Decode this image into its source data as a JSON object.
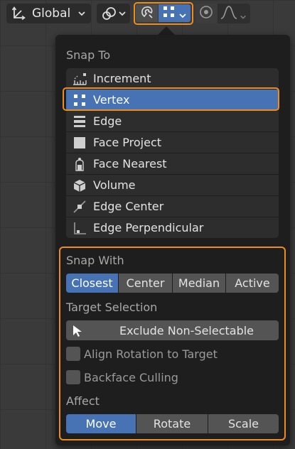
{
  "header": {
    "orientation_label": "Global"
  },
  "colors": {
    "accent": "#4772b3",
    "highlight": "#f08c1a",
    "popover_bg": "#1e1e1e",
    "button_bg": "#545454"
  },
  "snap_to": {
    "title": "Snap To",
    "items": [
      {
        "label": "Increment",
        "icon": "increment-icon",
        "selected": false
      },
      {
        "label": "Vertex",
        "icon": "vertex-icon",
        "selected": true
      },
      {
        "label": "Edge",
        "icon": "edge-icon",
        "selected": false
      },
      {
        "label": "Face Project",
        "icon": "face-project-icon",
        "selected": false
      },
      {
        "label": "Face Nearest",
        "icon": "face-nearest-icon",
        "selected": false
      },
      {
        "label": "Volume",
        "icon": "volume-icon",
        "selected": false
      },
      {
        "label": "Edge Center",
        "icon": "edge-center-icon",
        "selected": false
      },
      {
        "label": "Edge Perpendicular",
        "icon": "edge-perpendicular-icon",
        "selected": false
      }
    ]
  },
  "snap_with": {
    "title": "Snap With",
    "options": [
      "Closest",
      "Center",
      "Median",
      "Active"
    ],
    "selected": "Closest"
  },
  "target_selection": {
    "title": "Target Selection",
    "button_label": "Exclude Non-Selectable"
  },
  "checkboxes": {
    "align_rotation": {
      "label": "Align Rotation to Target",
      "checked": false
    },
    "backface_culling": {
      "label": "Backface Culling",
      "checked": false
    }
  },
  "affect": {
    "title": "Affect",
    "options": [
      "Move",
      "Rotate",
      "Scale"
    ],
    "selected": "Move"
  }
}
